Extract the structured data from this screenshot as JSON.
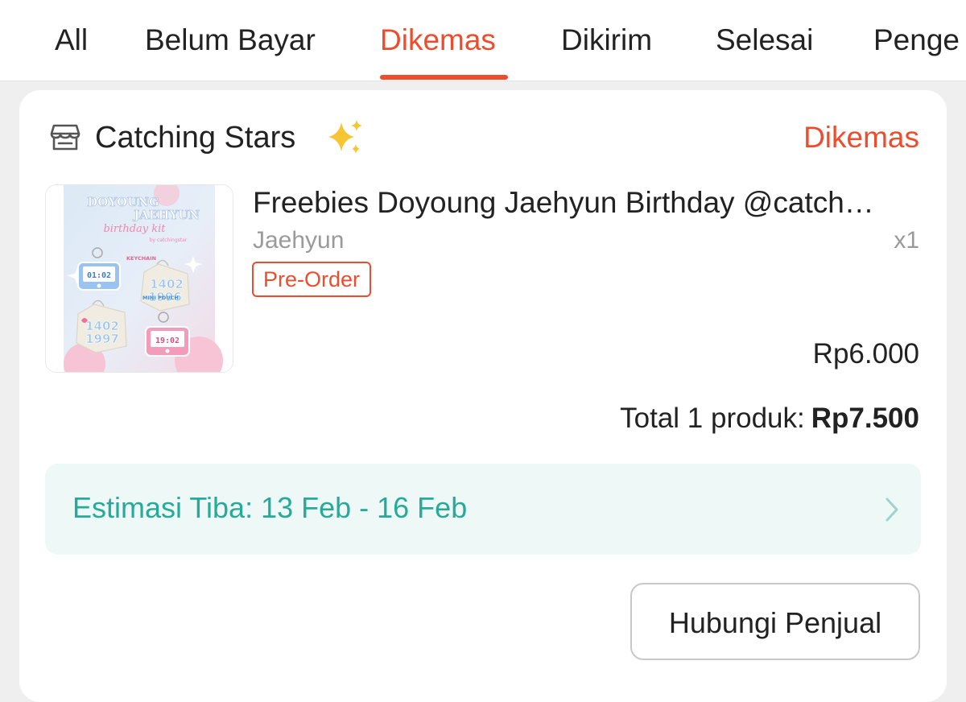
{
  "tabs": [
    {
      "label": "All"
    },
    {
      "label": "Belum Bayar"
    },
    {
      "label": "Dikemas",
      "active": true
    },
    {
      "label": "Dikirim"
    },
    {
      "label": "Selesai"
    },
    {
      "label": "Penge"
    }
  ],
  "order": {
    "shop_name": "Catching Stars",
    "shop_icon": "store-icon",
    "status": "Dikemas",
    "product": {
      "title": "Freebies Doyoung Jaehyun Birthday @catch…",
      "variant": "Jaehyun",
      "quantity": "x1",
      "tag": "Pre-Order",
      "price": "Rp6.000",
      "image_text": {
        "heading_line1": "DOYOUNG",
        "heading_line2": "JAEHYUN",
        "subtitle": "birthday kit",
        "byline": "by catchingstar",
        "label_keychain": "KEYCHAIN",
        "label_pouch": "MINI POUCH",
        "screen_time_1": "01:02",
        "screen_time_2": "19:02",
        "pouch_number_1": "1402",
        "pouch_number_2": "1996",
        "pouch_number_3": "1402",
        "pouch_number_4": "1997"
      }
    },
    "total_label": "Total 1 produk:",
    "total_amount": "Rp7.500",
    "eta": "Estimasi Tiba: 13 Feb - 16 Feb",
    "contact_button": "Hubungi Penjual"
  },
  "colors": {
    "accent": "#ee4d2d",
    "eta_text": "#26aa99",
    "eta_bg": "#eef8f6"
  }
}
